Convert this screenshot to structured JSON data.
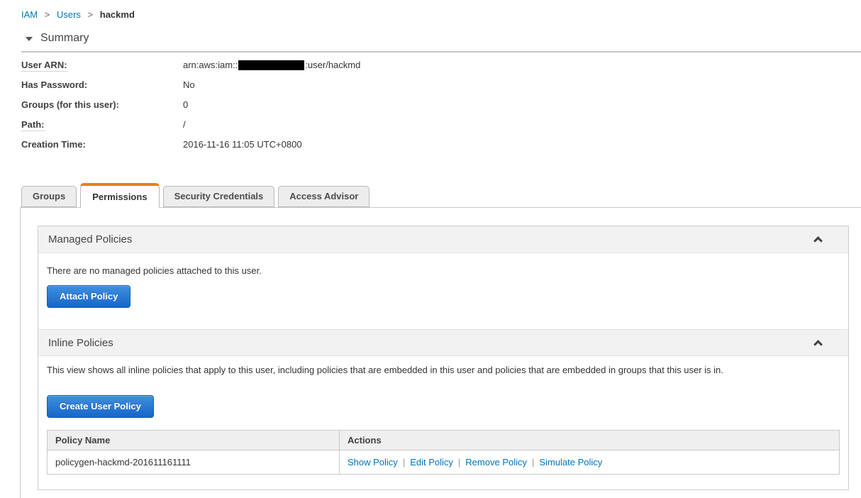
{
  "breadcrumb": {
    "separator": ">",
    "items": [
      {
        "label": "IAM"
      },
      {
        "label": "Users"
      },
      {
        "label": "hackmd"
      }
    ]
  },
  "summary": {
    "title": "Summary",
    "fields": [
      {
        "label": "User ARN:",
        "value_prefix": "arn:aws:iam::",
        "value_redacted": "account-id-hidden",
        "value_suffix": ":user/hackmd"
      },
      {
        "label": "Has Password:",
        "value": "No"
      },
      {
        "label": "Groups (for this user):",
        "value": "0"
      },
      {
        "label": "Path:",
        "value": "/"
      },
      {
        "label": "Creation Time:",
        "value": "2016-11-16 11:05 UTC+0800"
      }
    ]
  },
  "tabs": [
    {
      "label": "Groups"
    },
    {
      "label": "Permissions"
    },
    {
      "label": "Security Credentials"
    },
    {
      "label": "Access Advisor"
    }
  ],
  "active_tab": "Permissions",
  "managed_policies": {
    "title": "Managed Policies",
    "empty_text": "There are no managed policies attached to this user.",
    "attach_button": "Attach Policy"
  },
  "inline_policies": {
    "title": "Inline Policies",
    "description": "This view shows all inline policies that apply to this user, including policies that are embedded in this user and policies that are embedded in groups that this user is in.",
    "create_button": "Create User Policy",
    "actions_separator": "|",
    "table": {
      "columns": [
        "Policy Name",
        "Actions"
      ],
      "rows": [
        {
          "policy_name": "policygen-hackmd-201611161111",
          "actions": [
            "Show Policy",
            "Edit Policy",
            "Remove Policy",
            "Simulate Policy"
          ]
        }
      ]
    }
  },
  "colors": {
    "accent_orange": "#ee7f01",
    "link_blue": "#0073bb",
    "button_blue": "#1766c8"
  }
}
